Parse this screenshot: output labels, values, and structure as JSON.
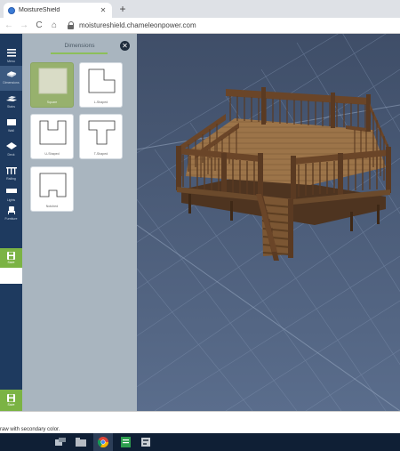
{
  "browser": {
    "tab_title": "MoistureShield",
    "tab_close": "✕",
    "new_tab": "+",
    "back": "←",
    "forward": "→",
    "reload": "C",
    "home": "⌂",
    "url": "moistureshield.chameleonpower.com"
  },
  "leftbar": {
    "items": [
      {
        "label": "Menu",
        "icon": "menu-icon"
      },
      {
        "label": "Dimensions",
        "icon": "deck-icon"
      },
      {
        "label": "Stairs",
        "icon": "stairs-icon"
      },
      {
        "label": "Wall",
        "icon": "wall-icon"
      },
      {
        "label": "Deck",
        "icon": "deck-surface-icon"
      },
      {
        "label": "Railing",
        "icon": "railing-icon"
      },
      {
        "label": "Lights",
        "icon": "lights-icon"
      },
      {
        "label": "Furniture",
        "icon": "furniture-icon"
      }
    ],
    "save_label": "Save",
    "save_label_bottom": "Save"
  },
  "panel": {
    "title": "Dimensions",
    "close": "✕",
    "shapes": [
      {
        "label": "Square",
        "icon": "square-shape-icon",
        "selected": true
      },
      {
        "label": "L-Shaped",
        "icon": "l-shape-icon",
        "selected": false
      },
      {
        "label": "U-Shaped",
        "icon": "u-shape-icon",
        "selected": false
      },
      {
        "label": "T-Shaped",
        "icon": "t-shape-icon",
        "selected": false
      },
      {
        "label": "Notched",
        "icon": "notched-shape-icon",
        "selected": false
      }
    ]
  },
  "status": {
    "text": "raw with secondary color."
  },
  "colors": {
    "leftbar": "#1e3a5f",
    "accent": "#7bb344",
    "panel": "#a9b5bf",
    "viewport": "#4a5a75",
    "deck": "#7a5230"
  }
}
